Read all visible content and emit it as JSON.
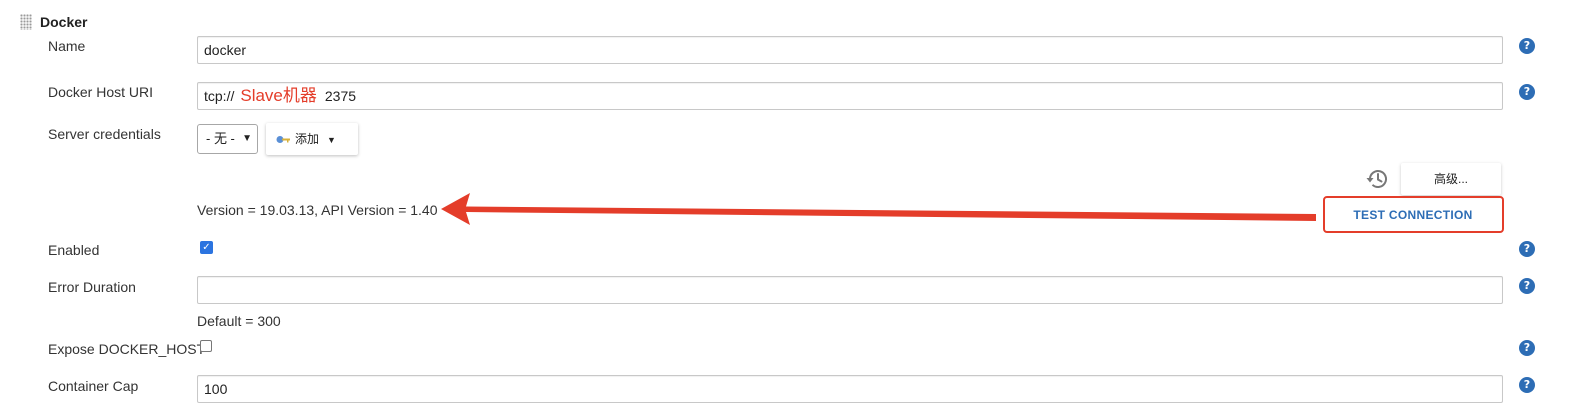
{
  "section": {
    "title": "Docker"
  },
  "fields": {
    "name": {
      "label": "Name",
      "value": "docker"
    },
    "host_uri": {
      "label": "Docker Host URI",
      "prefix": "tcp://",
      "annotation": "Slave机器",
      "port": "2375"
    },
    "credentials": {
      "label": "Server credentials",
      "selected": "- 无 -",
      "add_label": "添加"
    },
    "enabled": {
      "label": "Enabled",
      "checked": true
    },
    "error_duration": {
      "label": "Error Duration",
      "value": "",
      "hint": "Default = 300"
    },
    "expose_docker_host": {
      "label": "Expose DOCKER_HOST",
      "checked": false
    },
    "container_cap": {
      "label": "Container Cap",
      "value": "100"
    }
  },
  "buttons": {
    "advanced": "高级...",
    "test_connection": "TEST CONNECTION"
  },
  "status": {
    "version_text": "Version = 19.03.13, API Version = 1.40"
  },
  "help": {
    "glyph": "?"
  },
  "colors": {
    "accent_red": "#e43d2a",
    "help_blue": "#2d6db5",
    "checkbox_blue": "#2b74e0"
  }
}
